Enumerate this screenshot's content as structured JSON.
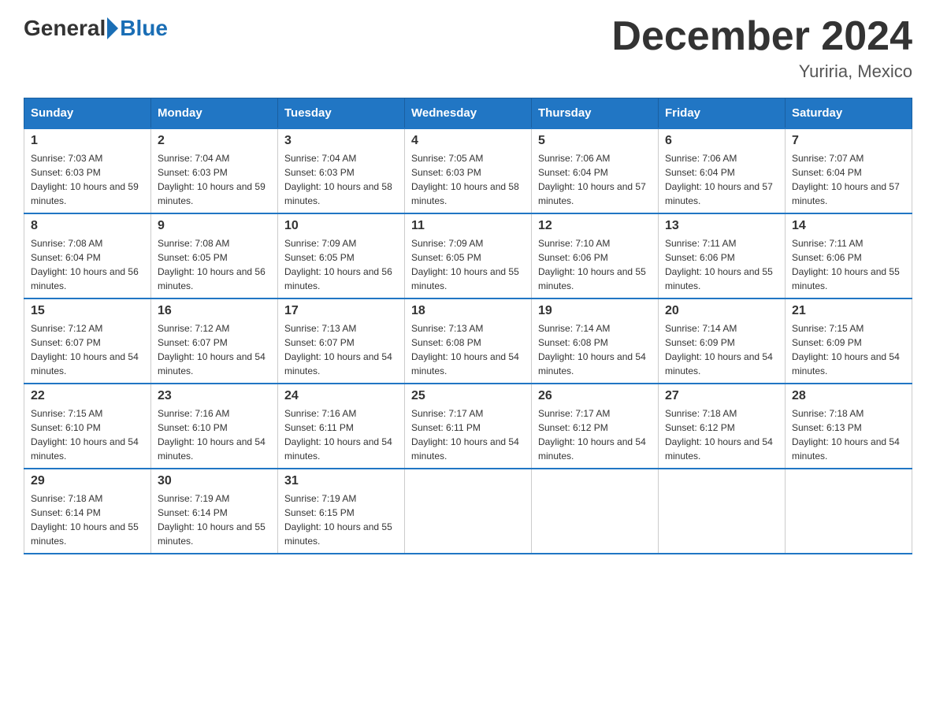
{
  "header": {
    "logo_general": "General",
    "logo_blue": "Blue",
    "month_title": "December 2024",
    "location": "Yuriria, Mexico"
  },
  "days_of_week": [
    "Sunday",
    "Monday",
    "Tuesday",
    "Wednesday",
    "Thursday",
    "Friday",
    "Saturday"
  ],
  "weeks": [
    [
      {
        "day": "1",
        "sunrise": "7:03 AM",
        "sunset": "6:03 PM",
        "daylight": "10 hours and 59 minutes."
      },
      {
        "day": "2",
        "sunrise": "7:04 AM",
        "sunset": "6:03 PM",
        "daylight": "10 hours and 59 minutes."
      },
      {
        "day": "3",
        "sunrise": "7:04 AM",
        "sunset": "6:03 PM",
        "daylight": "10 hours and 58 minutes."
      },
      {
        "day": "4",
        "sunrise": "7:05 AM",
        "sunset": "6:03 PM",
        "daylight": "10 hours and 58 minutes."
      },
      {
        "day": "5",
        "sunrise": "7:06 AM",
        "sunset": "6:04 PM",
        "daylight": "10 hours and 57 minutes."
      },
      {
        "day": "6",
        "sunrise": "7:06 AM",
        "sunset": "6:04 PM",
        "daylight": "10 hours and 57 minutes."
      },
      {
        "day": "7",
        "sunrise": "7:07 AM",
        "sunset": "6:04 PM",
        "daylight": "10 hours and 57 minutes."
      }
    ],
    [
      {
        "day": "8",
        "sunrise": "7:08 AM",
        "sunset": "6:04 PM",
        "daylight": "10 hours and 56 minutes."
      },
      {
        "day": "9",
        "sunrise": "7:08 AM",
        "sunset": "6:05 PM",
        "daylight": "10 hours and 56 minutes."
      },
      {
        "day": "10",
        "sunrise": "7:09 AM",
        "sunset": "6:05 PM",
        "daylight": "10 hours and 56 minutes."
      },
      {
        "day": "11",
        "sunrise": "7:09 AM",
        "sunset": "6:05 PM",
        "daylight": "10 hours and 55 minutes."
      },
      {
        "day": "12",
        "sunrise": "7:10 AM",
        "sunset": "6:06 PM",
        "daylight": "10 hours and 55 minutes."
      },
      {
        "day": "13",
        "sunrise": "7:11 AM",
        "sunset": "6:06 PM",
        "daylight": "10 hours and 55 minutes."
      },
      {
        "day": "14",
        "sunrise": "7:11 AM",
        "sunset": "6:06 PM",
        "daylight": "10 hours and 55 minutes."
      }
    ],
    [
      {
        "day": "15",
        "sunrise": "7:12 AM",
        "sunset": "6:07 PM",
        "daylight": "10 hours and 54 minutes."
      },
      {
        "day": "16",
        "sunrise": "7:12 AM",
        "sunset": "6:07 PM",
        "daylight": "10 hours and 54 minutes."
      },
      {
        "day": "17",
        "sunrise": "7:13 AM",
        "sunset": "6:07 PM",
        "daylight": "10 hours and 54 minutes."
      },
      {
        "day": "18",
        "sunrise": "7:13 AM",
        "sunset": "6:08 PM",
        "daylight": "10 hours and 54 minutes."
      },
      {
        "day": "19",
        "sunrise": "7:14 AM",
        "sunset": "6:08 PM",
        "daylight": "10 hours and 54 minutes."
      },
      {
        "day": "20",
        "sunrise": "7:14 AM",
        "sunset": "6:09 PM",
        "daylight": "10 hours and 54 minutes."
      },
      {
        "day": "21",
        "sunrise": "7:15 AM",
        "sunset": "6:09 PM",
        "daylight": "10 hours and 54 minutes."
      }
    ],
    [
      {
        "day": "22",
        "sunrise": "7:15 AM",
        "sunset": "6:10 PM",
        "daylight": "10 hours and 54 minutes."
      },
      {
        "day": "23",
        "sunrise": "7:16 AM",
        "sunset": "6:10 PM",
        "daylight": "10 hours and 54 minutes."
      },
      {
        "day": "24",
        "sunrise": "7:16 AM",
        "sunset": "6:11 PM",
        "daylight": "10 hours and 54 minutes."
      },
      {
        "day": "25",
        "sunrise": "7:17 AM",
        "sunset": "6:11 PM",
        "daylight": "10 hours and 54 minutes."
      },
      {
        "day": "26",
        "sunrise": "7:17 AM",
        "sunset": "6:12 PM",
        "daylight": "10 hours and 54 minutes."
      },
      {
        "day": "27",
        "sunrise": "7:18 AM",
        "sunset": "6:12 PM",
        "daylight": "10 hours and 54 minutes."
      },
      {
        "day": "28",
        "sunrise": "7:18 AM",
        "sunset": "6:13 PM",
        "daylight": "10 hours and 54 minutes."
      }
    ],
    [
      {
        "day": "29",
        "sunrise": "7:18 AM",
        "sunset": "6:14 PM",
        "daylight": "10 hours and 55 minutes."
      },
      {
        "day": "30",
        "sunrise": "7:19 AM",
        "sunset": "6:14 PM",
        "daylight": "10 hours and 55 minutes."
      },
      {
        "day": "31",
        "sunrise": "7:19 AM",
        "sunset": "6:15 PM",
        "daylight": "10 hours and 55 minutes."
      },
      null,
      null,
      null,
      null
    ]
  ]
}
